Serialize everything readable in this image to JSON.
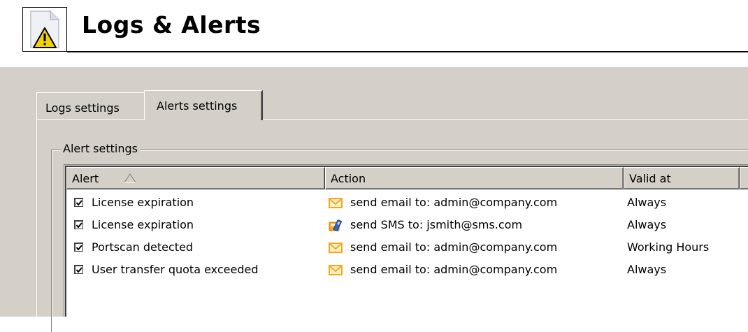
{
  "page": {
    "title": "Logs & Alerts",
    "icon": "warning-document-icon"
  },
  "tabs": [
    {
      "label": "Logs settings",
      "active": false
    },
    {
      "label": "Alerts settings",
      "active": true
    }
  ],
  "groupbox": {
    "legend": "Alert settings"
  },
  "alerts_table": {
    "columns": [
      "Alert",
      "Action",
      "Valid at",
      ""
    ],
    "sort": {
      "column": "Alert",
      "direction": "ascending"
    },
    "rows": [
      {
        "checked": true,
        "alert": "License expiration",
        "action_icon": "email-icon",
        "action": "send email to: admin@company.com",
        "valid_at": "Always"
      },
      {
        "checked": true,
        "alert": "License expiration",
        "action_icon": "sms-phone-icon",
        "action": "send SMS to: jsmith@sms.com",
        "valid_at": "Always"
      },
      {
        "checked": true,
        "alert": "Portscan detected",
        "action_icon": "email-icon",
        "action": "send email to: admin@company.com",
        "valid_at": "Working Hours"
      },
      {
        "checked": true,
        "alert": "User transfer quota exceeded",
        "action_icon": "email-icon",
        "action": "send email to: admin@company.com",
        "valid_at": "Always"
      }
    ]
  },
  "colors": {
    "panel": "#d4d0c8",
    "email_icon": "#f5a623",
    "warning_icon": "#f2d200"
  }
}
